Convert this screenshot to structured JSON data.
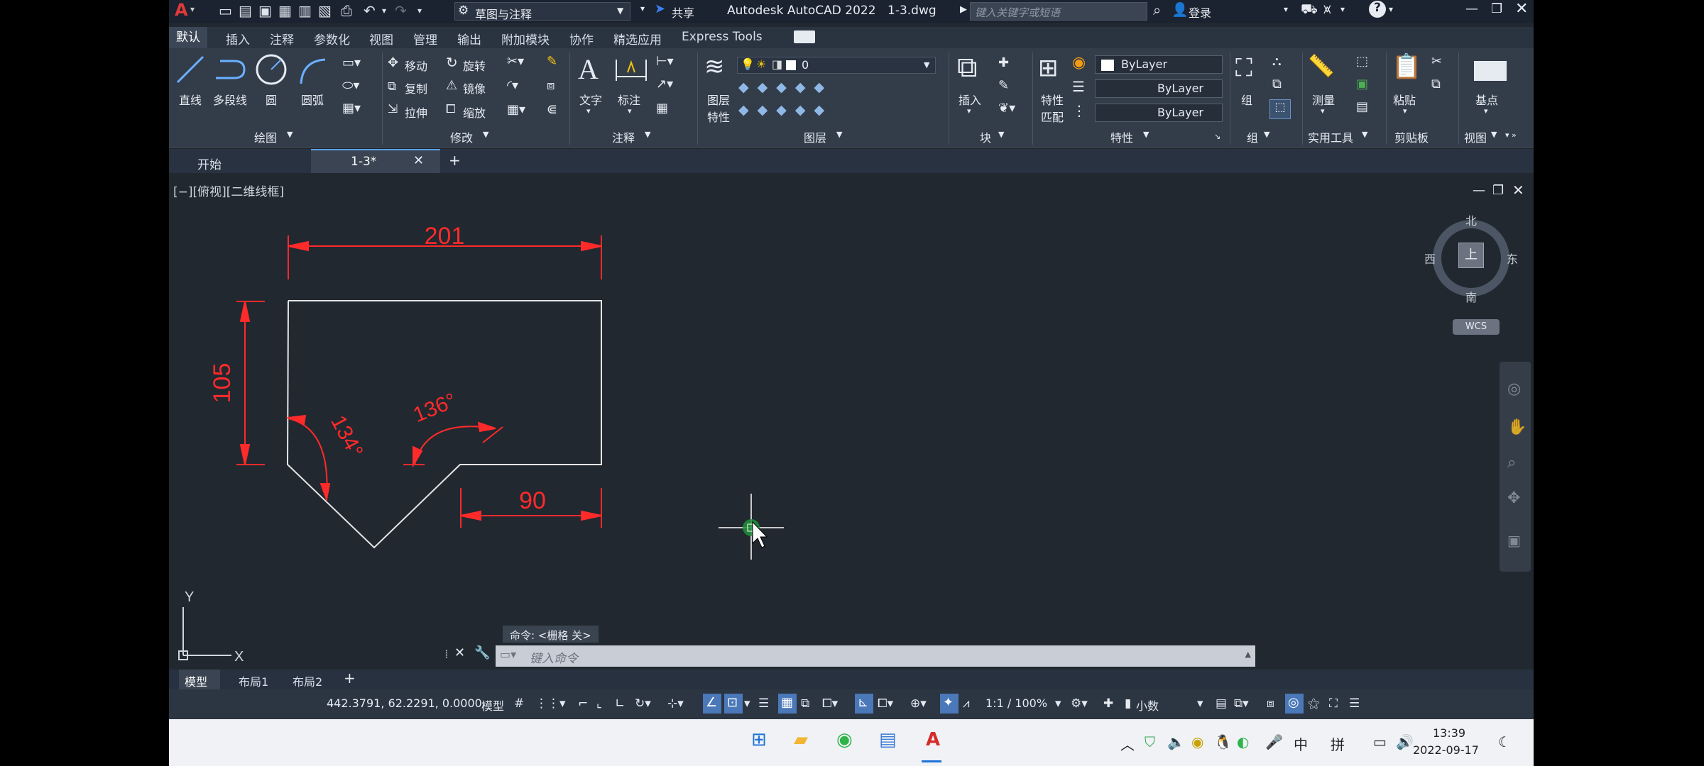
{
  "window": {
    "app_title": "Autodesk AutoCAD 2022",
    "file_name": "1-3.dwg",
    "workspace": "草图与注释",
    "share": "共享",
    "search_placeholder": "键入关键字或短语",
    "login": "登录"
  },
  "ribbon_tabs": [
    "默认",
    "插入",
    "注释",
    "参数化",
    "视图",
    "管理",
    "输出",
    "附加模块",
    "协作",
    "精选应用",
    "Express Tools"
  ],
  "draw_panel": {
    "line": "直线",
    "polyline": "多段线",
    "circle": "圆",
    "arc": "圆弧",
    "group": "绘图"
  },
  "modify_panel": {
    "move": "移动",
    "rotate": "旋转",
    "copy": "复制",
    "mirror": "镜像",
    "stretch": "拉伸",
    "scale": "缩放",
    "group": "修改"
  },
  "annotation_panel": {
    "text": "文字",
    "dimension": "标注",
    "group": "注释"
  },
  "layer_panel": {
    "props_line1": "图层",
    "props_line2": "特性",
    "current_layer": "0",
    "group": "图层"
  },
  "block_panel": {
    "insert": "插入",
    "group": "块"
  },
  "properties_panel": {
    "match_line1": "特性",
    "match_line2": "匹配",
    "color": "ByLayer",
    "linetype": "ByLayer",
    "lineweight": "ByLayer",
    "group": "特性"
  },
  "groups_panel": {
    "group_btn": "组",
    "group": "组"
  },
  "utilities_panel": {
    "measure": "测量",
    "group": "实用工具"
  },
  "clipboard_panel": {
    "paste": "粘贴",
    "group": "剪贴板"
  },
  "view_panel": {
    "base": "基点",
    "group": "视图"
  },
  "doc_tabs": {
    "start": "开始",
    "active": "1-3*"
  },
  "viewport": {
    "controls": "[−][俯视][二维线框]"
  },
  "viewcube": {
    "north": "北",
    "south": "南",
    "east": "东",
    "west": "西",
    "face": "上",
    "wcs": "WCS"
  },
  "drawing": {
    "dim_top": "201",
    "dim_left": "105",
    "dim_bottom": "90",
    "angle_left": "134°",
    "angle_right": "136°",
    "ucs_y": "Y",
    "ucs_x": "X"
  },
  "command": {
    "history": "命令: <栅格 关>",
    "placeholder": "键入命令"
  },
  "layout_tabs": [
    "模型",
    "布局1",
    "布局2"
  ],
  "status": {
    "coords": "442.3791, 62.2291, 0.0000",
    "model": "模型",
    "scale": "1:1 / 100%",
    "units": "小数"
  },
  "taskbar": {
    "time": "13:39",
    "date": "2022-09-17",
    "ime_lang": "中",
    "ime_mode": "拼"
  },
  "colors": {
    "dimension": "#ff2a2a",
    "geometry": "#e6e6e6",
    "background": "#212830",
    "ribbon": "#333c49"
  }
}
